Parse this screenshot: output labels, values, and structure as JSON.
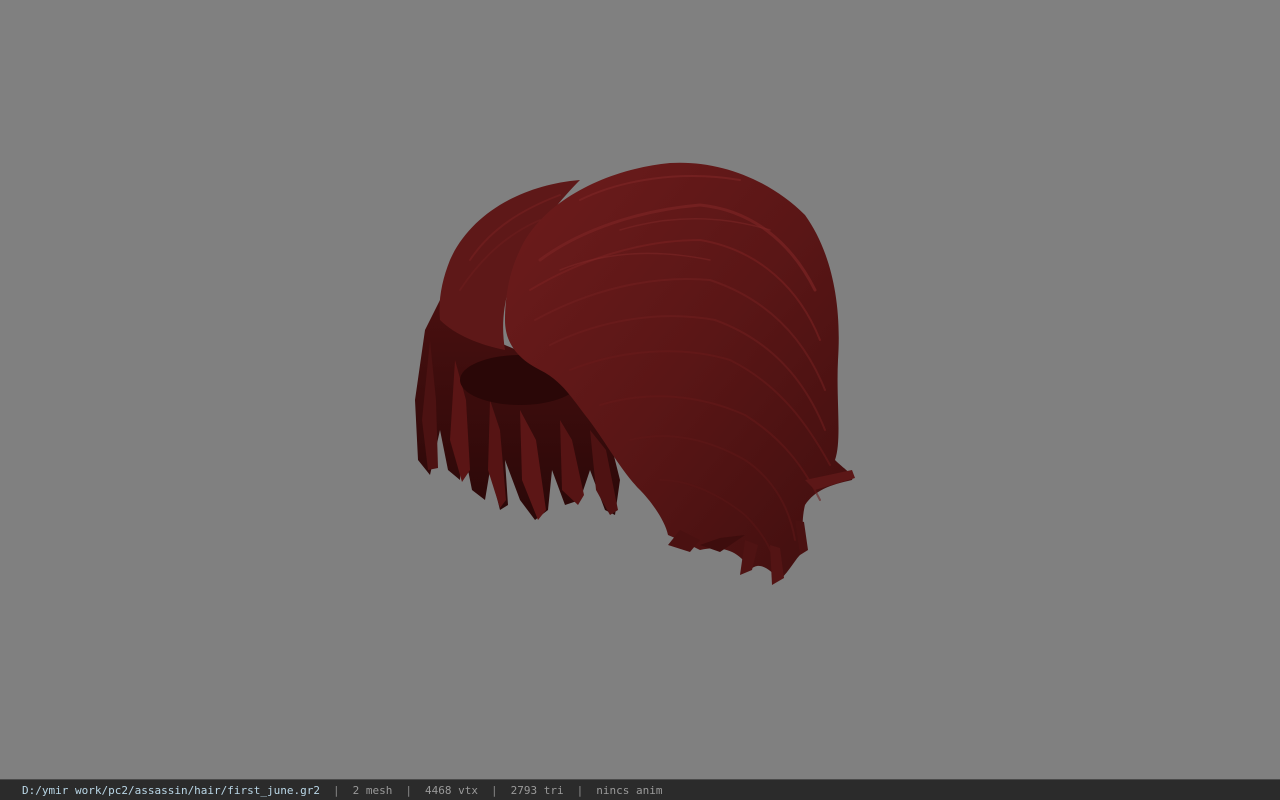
{
  "viewer": {
    "background_color": "#808080",
    "model_color": "#5a1515",
    "model_name": "hair-mesh"
  },
  "statusbar": {
    "path": "D:/ymir work/pc2/assassin/hair/first_june.gr2",
    "separator": "|",
    "mesh": "2 mesh",
    "vtx": "4468 vtx",
    "tri": "2793 tri",
    "anim": "nincs anim"
  }
}
